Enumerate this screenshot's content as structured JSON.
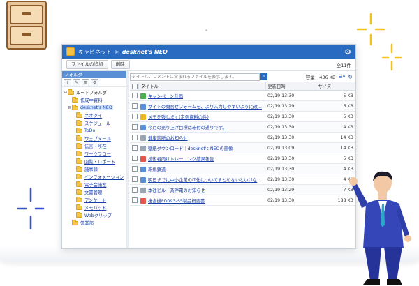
{
  "window": {
    "title_section": "キャビネット",
    "title_separator": ">",
    "brand": "desknet's NEO"
  },
  "toolbar": {
    "add_file": "ファイルの追加",
    "delete": "削除",
    "total_count": "全11件"
  },
  "folder_pane": {
    "header": "フォルダ",
    "tree": [
      {
        "label": "ルートフォルダ",
        "level": 0,
        "expander": "⊟"
      },
      {
        "label": "作成中資料",
        "level": 1,
        "expander": ""
      },
      {
        "label": "desknet's NEO",
        "level": 1,
        "expander": "⊟",
        "selected": true
      },
      {
        "label": "ネオツイ",
        "level": 2,
        "expander": ""
      },
      {
        "label": "スケジュール",
        "level": 2,
        "expander": ""
      },
      {
        "label": "ToDo",
        "level": 2,
        "expander": ""
      },
      {
        "label": "ウェブメール",
        "level": 2,
        "expander": ""
      },
      {
        "label": "伝言・所在",
        "level": 2,
        "expander": ""
      },
      {
        "label": "ワークフロー",
        "level": 2,
        "expander": ""
      },
      {
        "label": "回覧・レポート",
        "level": 2,
        "expander": ""
      },
      {
        "label": "議事録",
        "level": 2,
        "expander": ""
      },
      {
        "label": "インフォメーション",
        "level": 2,
        "expander": ""
      },
      {
        "label": "電子会議室",
        "level": 2,
        "expander": ""
      },
      {
        "label": "文書管理",
        "level": 2,
        "expander": ""
      },
      {
        "label": "アンケート",
        "level": 2,
        "expander": ""
      },
      {
        "label": "メモパッド",
        "level": 2,
        "expander": ""
      },
      {
        "label": "Webクリップ",
        "level": 2,
        "expander": ""
      },
      {
        "label": "営業部",
        "level": 1,
        "expander": ""
      }
    ]
  },
  "search": {
    "placeholder": "タイトル、コメントに含まれるファイルを表示します。",
    "capacity": "容量：436 KB"
  },
  "table": {
    "columns": {
      "title": "タイトル",
      "updated": "更新日時",
      "size": "サイズ"
    },
    "rows": [
      {
        "title": "キャンペーン計画",
        "updated": "02/19 13:30",
        "size": "5 KB",
        "icon_color": "#4caf50"
      },
      {
        "title": "サイトの問合せフォームを、より入力しやすいように改...",
        "updated": "02/19 13:29",
        "size": "6 KB",
        "icon_color": "#5b8fd8"
      },
      {
        "title": "メモを残します(定例資料の件)",
        "updated": "02/19 13:30",
        "size": "5 KB",
        "icon_color": "#f0b429"
      },
      {
        "title": "今月の売り上げ目標は赤付の通りです。",
        "updated": "02/19 13:30",
        "size": "4 KB",
        "icon_color": "#5b8fd8"
      },
      {
        "title": "健康診断のお知らせ",
        "updated": "02/19 13:30",
        "size": "14 KB",
        "icon_color": "#9aa6b2"
      },
      {
        "title": "壁紙ダウンロード｜desknet's NEOの画像",
        "updated": "02/19 13:09",
        "size": "14 KB",
        "icon_color": "#9aa6b2"
      },
      {
        "title": "技術者向けトレーニング結果報告",
        "updated": "02/19 13:30",
        "size": "5 KB",
        "icon_color": "#e2574c"
      },
      {
        "title": "新規鉄道",
        "updated": "02/19 13:30",
        "size": "4 KB",
        "icon_color": "#5b8fd8"
      },
      {
        "title": "明日までに中小企業のIT化についてまとめないといけない...",
        "updated": "02/19 13:30",
        "size": "4 KB",
        "icon_color": "#5b8fd8"
      },
      {
        "title": "本社ビル一斉停電のお知らせ",
        "updated": "02/19 13:29",
        "size": "7 KB",
        "icon_color": "#9aa6b2"
      },
      {
        "title": "複合機PD093-S5製品概要書",
        "updated": "02/19 13:30",
        "size": "188 KB",
        "icon_color": "#e2574c"
      }
    ]
  }
}
